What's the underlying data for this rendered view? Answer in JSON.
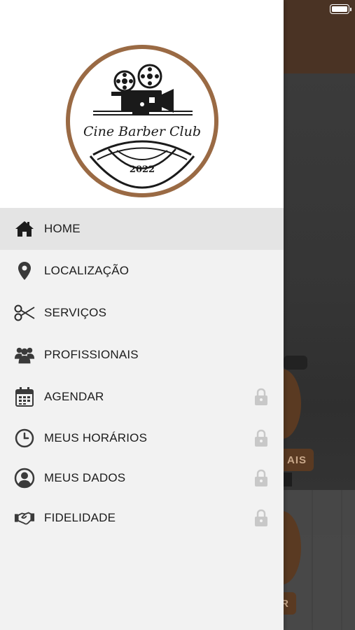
{
  "logo": {
    "brand_name": "Cine Barber Club",
    "year": "2022"
  },
  "menu": {
    "items": [
      {
        "label": "HOME",
        "icon": "home-icon",
        "locked": false,
        "active": true
      },
      {
        "label": "LOCALIZAÇÃO",
        "icon": "location-pin-icon",
        "locked": false,
        "active": false
      },
      {
        "label": "SERVIÇOS",
        "icon": "scissors-icon",
        "locked": false,
        "active": false
      },
      {
        "label": "PROFISSIONAIS",
        "icon": "people-icon",
        "locked": false,
        "active": false
      },
      {
        "label": "AGENDAR",
        "icon": "calendar-icon",
        "locked": true,
        "active": false
      },
      {
        "label": "MEUS HORÁRIOS",
        "icon": "clock-icon",
        "locked": true,
        "active": false
      },
      {
        "label": "MEUS DADOS",
        "icon": "user-circle-icon",
        "locked": true,
        "active": false
      },
      {
        "label": "FIDELIDADE",
        "icon": "handshake-icon",
        "locked": true,
        "active": false
      }
    ]
  },
  "background": {
    "chip_1": "AIS",
    "chip_2": "R"
  },
  "colors": {
    "brand_brown": "#9a6a44",
    "header_brown": "#4a3324",
    "active_row": "#e4e4e4",
    "lock_gray": "#c8c8c8"
  }
}
